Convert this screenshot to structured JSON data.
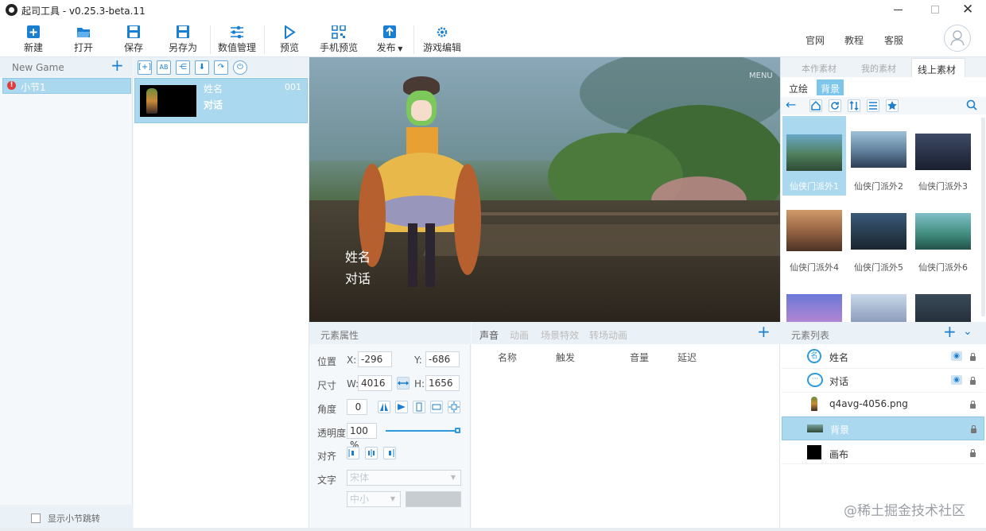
{
  "window": {
    "title": "起司工具 - v0.25.3-beta.11"
  },
  "toolbar": {
    "new_label": "新建",
    "open_label": "打开",
    "save_label": "保存",
    "save_as_label": "另存为",
    "numeric_label": "数值管理",
    "preview_label": "预览",
    "mobile_preview_label": "手机预览",
    "publish_label": "发布",
    "game_edit_label": "游戏编辑",
    "website_label": "官网",
    "tutorial_label": "教程",
    "service_label": "客服"
  },
  "left_panel": {
    "title": "New Game",
    "chapters": [
      {
        "name": "小节1"
      }
    ],
    "show_jump_label": "显示小节跳转"
  },
  "frames": [
    {
      "name_label": "姓名",
      "dialog_label": "对话",
      "number": "001"
    }
  ],
  "stage": {
    "name_text": "姓名",
    "dialog_text": "对话",
    "menu_text": "MENU"
  },
  "assets": {
    "tabs": [
      "本作素材",
      "我的素材",
      "线上素材"
    ],
    "active_tab": "线上素材",
    "subtabs": [
      "立绘",
      "背景"
    ],
    "active_subtab": "背景",
    "items": [
      "仙侠门派外1",
      "仙侠门派外2",
      "仙侠门派外3",
      "仙侠门派外4",
      "仙侠门派外5",
      "仙侠门派外6"
    ]
  },
  "props": {
    "title": "元素属性",
    "position_label": "位置",
    "x_label": "X:",
    "x_value": "-296",
    "y_label": "Y:",
    "y_value": "-686",
    "size_label": "尺寸",
    "w_label": "W:",
    "w_value": "4016",
    "h_label": "H:",
    "h_value": "1656",
    "angle_label": "角度",
    "angle_value": "0",
    "opacity_label": "透明度",
    "opacity_value": "100 %",
    "opacity_fraction": 1.0,
    "align_label": "对齐",
    "text_label": "文字",
    "font_value": "宋体",
    "size_value": "中小"
  },
  "sound": {
    "tabs": [
      "声音",
      "动画",
      "场景特效",
      "转场动画"
    ],
    "columns": [
      "名称",
      "触发",
      "音量",
      "延迟"
    ]
  },
  "elements": {
    "title": "元素列表",
    "items": [
      {
        "name": "姓名"
      },
      {
        "name": "对话"
      },
      {
        "name": "q4avg-4056.png"
      },
      {
        "name": "背景"
      },
      {
        "name": "画布"
      }
    ]
  },
  "watermark": "@稀土掘金技术社区",
  "colors": {
    "accent": "#1a7fd0",
    "selected": "#a9d8ef",
    "panel": "#eaf1f7"
  }
}
